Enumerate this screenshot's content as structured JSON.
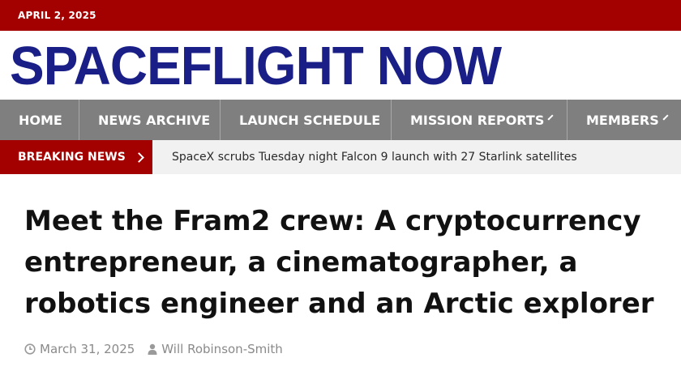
{
  "topbar": {
    "date": "APRIL 2, 2025"
  },
  "logo": {
    "text": "SPACEFLIGHT NOW"
  },
  "nav": {
    "items": [
      {
        "label": "HOME"
      },
      {
        "label": "NEWS ARCHIVE"
      },
      {
        "label": "LAUNCH SCHEDULE"
      },
      {
        "label": "MISSION REPORTS",
        "icon": "chevron-down-icon"
      },
      {
        "label": "MEMBERS",
        "icon": "chevron-down-icon"
      }
    ]
  },
  "breaking": {
    "label": "BREAKING NEWS",
    "icon": "chevron-right-icon",
    "headline": "SpaceX scrubs Tuesday night Falcon 9 launch with 27 Starlink satellites"
  },
  "article": {
    "title": "Meet the Fram2 crew: A cryptocurrency entrepreneur, a cinematographer, a robotics engineer and an Arctic explorer",
    "date": "March 31, 2025",
    "author": "Will Robinson-Smith"
  },
  "colors": {
    "brand_red": "#a30000",
    "logo_blue": "#1a1f88",
    "nav_gray": "#7f7f7f"
  }
}
